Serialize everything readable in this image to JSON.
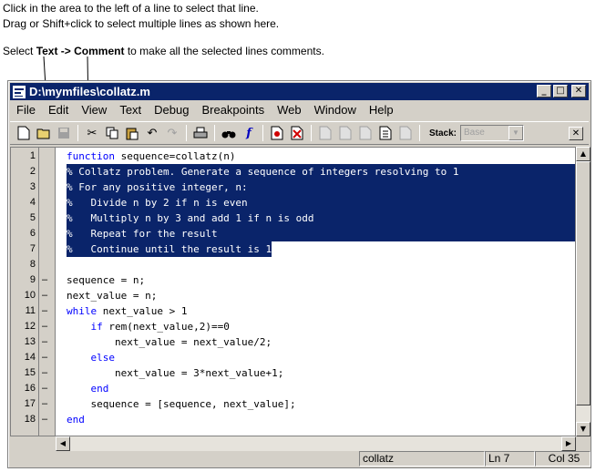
{
  "instructions": {
    "line1": "Click in the area to the left of a line to select that line.",
    "line2": "Drag or Shift+click to select multiple lines as shown here.",
    "line3_pre": "Select ",
    "line3_bold": "Text -> Comment",
    "line3_post": " to make all the selected lines comments."
  },
  "window": {
    "title": "D:\\mymfiles\\collatz.m",
    "minimize": "_",
    "maximize": "□",
    "close": "✕"
  },
  "menu": [
    "File",
    "Edit",
    "View",
    "Text",
    "Debug",
    "Breakpoints",
    "Web",
    "Window",
    "Help"
  ],
  "toolbar": {
    "icons": [
      "new-file-icon",
      "open-file-icon",
      "save-icon",
      "cut-icon",
      "copy-icon",
      "paste-icon",
      "undo-icon",
      "redo-icon",
      "print-icon",
      "find-icon",
      "function-icon",
      "set-breakpoint-icon",
      "clear-breakpoints-icon",
      "step-icon",
      "step-in-icon",
      "step-out-icon",
      "continue-icon",
      "exit-debug-icon"
    ],
    "stack_label": "Stack:",
    "stack_value": "Base",
    "close": "✕"
  },
  "editor": {
    "lines": [
      {
        "num": "1",
        "dash": "",
        "code": "function sequence=collatz(n)",
        "selected": false
      },
      {
        "num": "2",
        "dash": "",
        "code": "% Collatz problem. Generate a sequence of integers resolving to 1",
        "selected": true
      },
      {
        "num": "3",
        "dash": "",
        "code": "% For any positive integer, n:",
        "selected": true
      },
      {
        "num": "4",
        "dash": "",
        "code": "%   Divide n by 2 if n is even",
        "selected": true
      },
      {
        "num": "5",
        "dash": "",
        "code": "%   Multiply n by 3 and add 1 if n is odd",
        "selected": true
      },
      {
        "num": "6",
        "dash": "",
        "code": "%   Repeat for the result",
        "selected": true
      },
      {
        "num": "7",
        "dash": "",
        "code": "%   Continue until the result is 1",
        "selected": true
      },
      {
        "num": "8",
        "dash": "",
        "code": "",
        "selected": false
      },
      {
        "num": "9",
        "dash": "–",
        "code": "sequence = n;",
        "selected": false
      },
      {
        "num": "10",
        "dash": "–",
        "code": "next_value = n;",
        "selected": false
      },
      {
        "num": "11",
        "dash": "–",
        "code": "while next_value > 1",
        "selected": false
      },
      {
        "num": "12",
        "dash": "–",
        "code": "    if rem(next_value,2)==0",
        "selected": false
      },
      {
        "num": "13",
        "dash": "–",
        "code": "        next_value = next_value/2;",
        "selected": false
      },
      {
        "num": "14",
        "dash": "–",
        "code": "    else",
        "selected": false
      },
      {
        "num": "15",
        "dash": "–",
        "code": "        next_value = 3*next_value+1;",
        "selected": false
      },
      {
        "num": "16",
        "dash": "–",
        "code": "    end",
        "selected": false
      },
      {
        "num": "17",
        "dash": "–",
        "code": "    sequence = [sequence, next_value];",
        "selected": false
      },
      {
        "num": "18",
        "dash": "–",
        "code": "end",
        "selected": false
      }
    ]
  },
  "status": {
    "file": "collatz",
    "line": "Ln 7",
    "col": "Col 35"
  },
  "colors": {
    "selection": "#0a246a",
    "keyword": "#0000ff",
    "chrome": "#d4d0c8"
  }
}
